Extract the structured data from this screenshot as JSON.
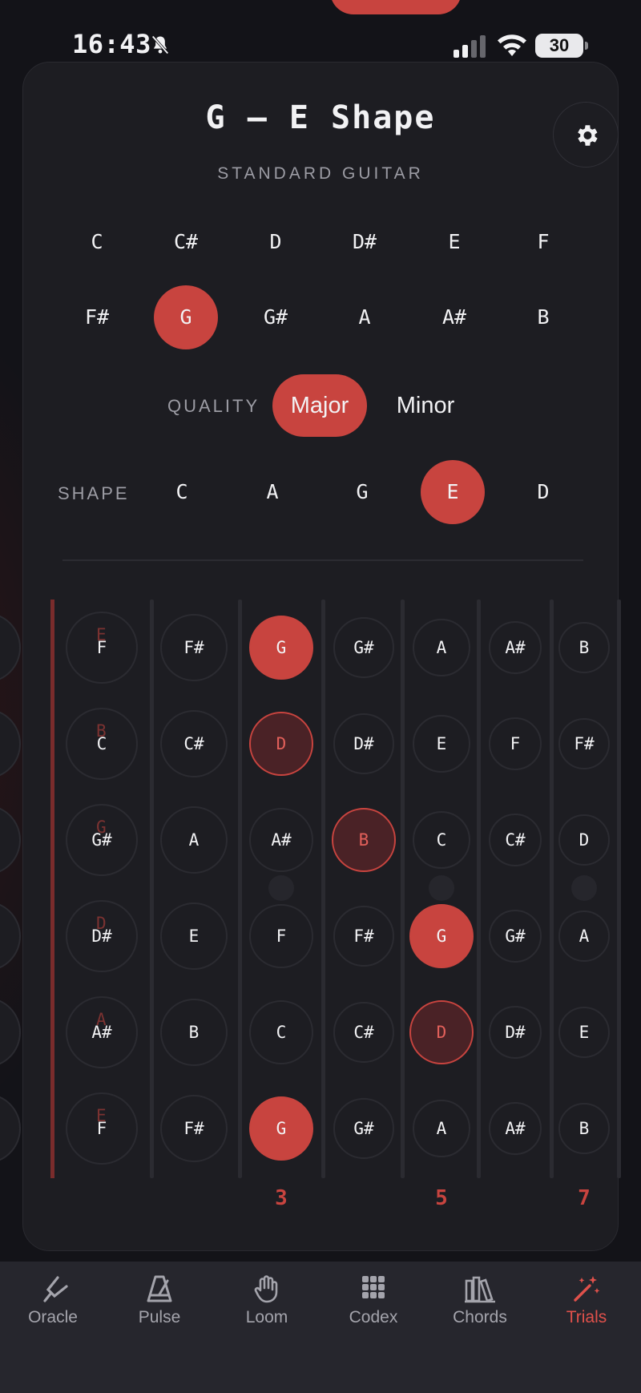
{
  "status_bar": {
    "time": "16:43",
    "battery": "30"
  },
  "header": {
    "title": "G — E Shape",
    "subtitle": "STANDARD GUITAR"
  },
  "keys": {
    "row1": [
      "C",
      "C#",
      "D",
      "D#",
      "E",
      "F"
    ],
    "row2": [
      "F#",
      "G",
      "G#",
      "A",
      "A#",
      "B"
    ],
    "selected": "G"
  },
  "quality": {
    "label": "QUALITY",
    "options": [
      "Major",
      "Minor"
    ],
    "selected": "Major"
  },
  "shape": {
    "label": "SHAPE",
    "options": [
      "C",
      "A",
      "G",
      "E",
      "D"
    ],
    "selected": "E"
  },
  "fretboard": {
    "strings": [
      {
        "open": "E",
        "frets": [
          "F",
          "F#",
          "G",
          "G#",
          "A",
          "A#",
          "B"
        ],
        "ghost": "E"
      },
      {
        "open": "B",
        "frets": [
          "C",
          "C#",
          "D",
          "D#",
          "E",
          "F",
          "F#"
        ],
        "ghost": "B"
      },
      {
        "open": "G",
        "frets": [
          "G#",
          "A",
          "A#",
          "B",
          "C",
          "C#",
          "D"
        ],
        "ghost": "G"
      },
      {
        "open": "D",
        "frets": [
          "D#",
          "E",
          "F",
          "F#",
          "G",
          "G#",
          "A"
        ],
        "ghost": "D"
      },
      {
        "open": "A",
        "frets": [
          "A#",
          "B",
          "C",
          "C#",
          "D",
          "D#",
          "E"
        ],
        "ghost": "A"
      },
      {
        "open": "E",
        "frets": [
          "F",
          "F#",
          "G",
          "G#",
          "A",
          "A#",
          "B"
        ],
        "ghost": "E"
      }
    ],
    "highlights": [
      {
        "string": 0,
        "fret": 3,
        "kind": "root"
      },
      {
        "string": 1,
        "fret": 3,
        "kind": "tone"
      },
      {
        "string": 2,
        "fret": 4,
        "kind": "tone"
      },
      {
        "string": 3,
        "fret": 5,
        "kind": "root"
      },
      {
        "string": 4,
        "fret": 5,
        "kind": "tone"
      },
      {
        "string": 5,
        "fret": 3,
        "kind": "root"
      }
    ],
    "fret_numbers": [
      {
        "fret": 3,
        "label": "3"
      },
      {
        "fret": 5,
        "label": "5"
      },
      {
        "fret": 7,
        "label": "7"
      }
    ]
  },
  "tabs": [
    {
      "label": "Oracle",
      "icon": "tuning-fork-icon",
      "active": false
    },
    {
      "label": "Pulse",
      "icon": "metronome-icon",
      "active": false
    },
    {
      "label": "Loom",
      "icon": "hand-icon",
      "active": false
    },
    {
      "label": "Codex",
      "icon": "grid-icon",
      "active": false
    },
    {
      "label": "Chords",
      "icon": "books-icon",
      "active": false
    },
    {
      "label": "Trials",
      "icon": "magic-wand-icon",
      "active": true
    }
  ],
  "colors": {
    "accent": "#c8443f",
    "card": "#1d1d22",
    "background": "#131318"
  }
}
